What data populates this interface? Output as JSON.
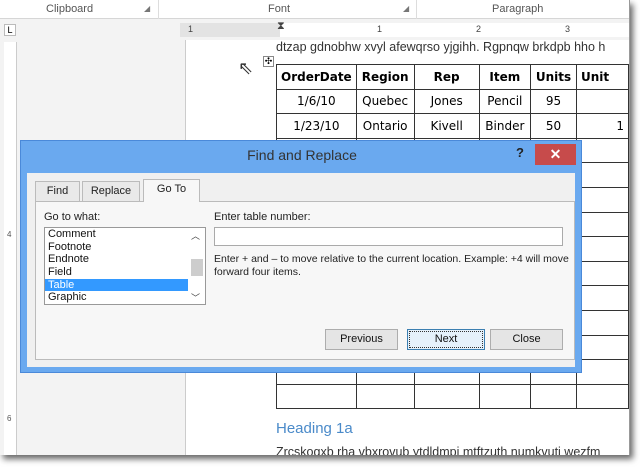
{
  "ribbon": {
    "groups": [
      "Clipboard",
      "Font",
      "Paragraph"
    ]
  },
  "ruler": {
    "marks": [
      "1",
      "1",
      "2",
      "3"
    ],
    "vertical_marks": [
      "4",
      "6"
    ]
  },
  "document": {
    "top_text": "dtzap gdnobhw xvyl afewqrso yjgihh. Rgpnqw brkdpb hho h",
    "table": {
      "headers": [
        "OrderDate",
        "Region",
        "Rep",
        "Item",
        "Units",
        "Unit"
      ],
      "rows": [
        [
          "1/6/10",
          "Quebec",
          "Jones",
          "Pencil",
          "95",
          ""
        ],
        [
          "1/23/10",
          "Ontario",
          "Kivell",
          "Binder",
          "50",
          "1"
        ]
      ]
    },
    "heading": "Heading 1a",
    "body_text": "Zrcskogxb rha vbxrovub ytdldmpi mtftzuth numkvuti wezfm"
  },
  "dialog": {
    "title": "Find and Replace",
    "help": "?",
    "close_glyph": "✕",
    "tabs": [
      {
        "label": "Find",
        "active": false
      },
      {
        "label": "Replace",
        "active": false
      },
      {
        "label": "Go To",
        "active": true
      }
    ],
    "goto_label": "Go to what:",
    "goto_items": [
      "Comment",
      "Footnote",
      "Endnote",
      "Field",
      "Table",
      "Graphic"
    ],
    "selected": "Table",
    "input_label": "Enter table number:",
    "input_value": "",
    "hint": "Enter + and – to move relative to the current location. Example: +4 will move forward four items.",
    "buttons": {
      "previous": "Previous",
      "next": "Next",
      "close": "Close"
    }
  }
}
